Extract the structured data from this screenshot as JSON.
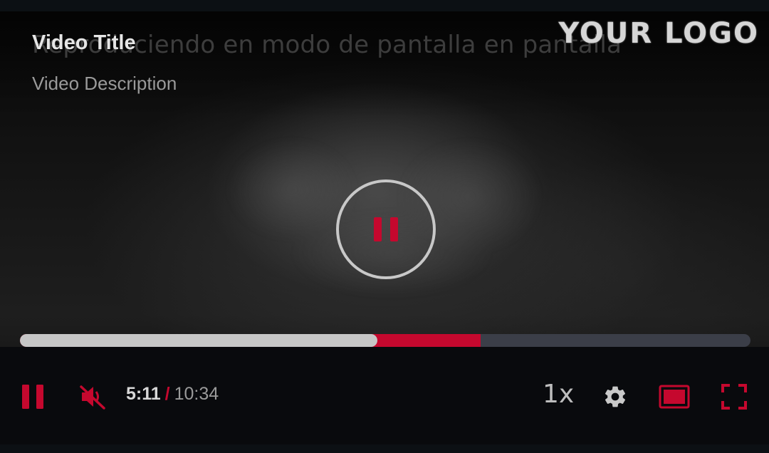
{
  "player": {
    "overlay_text": "Reproduciendo en modo de pantalla en pantalla",
    "title": "Video Title",
    "description": "Video Description",
    "logo": "YOUR LOGO"
  },
  "progress": {
    "played_fraction": 0.489,
    "buffered_fraction": 0.631
  },
  "controls": {
    "current_time": "5:11",
    "separator": "/",
    "duration": "10:34",
    "speed": "1x",
    "icons": [
      "pause-icon",
      "muted-speaker-icon",
      "gear-icon",
      "theater-mode-icon",
      "fullscreen-icon"
    ]
  },
  "colors": {
    "accent": "#c5082e",
    "played": "#c7c7c7",
    "track": "#3b3e48",
    "control_bar": "#090a0d"
  }
}
